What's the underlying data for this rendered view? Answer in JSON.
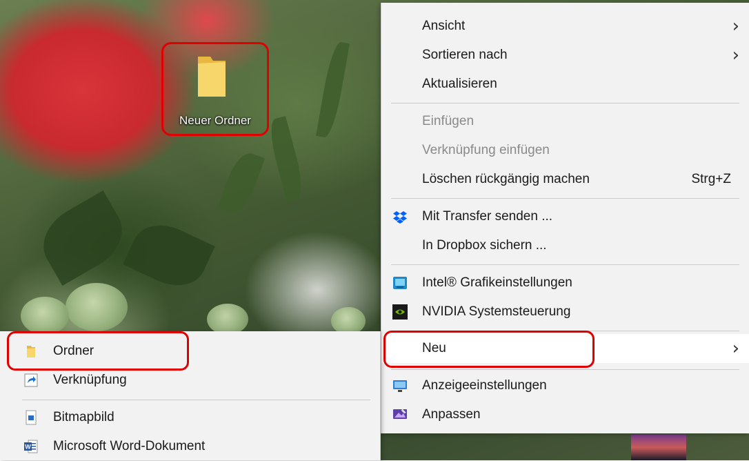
{
  "desktop": {
    "icon": {
      "name": "folder-icon",
      "label": "Neuer Ordner"
    }
  },
  "context_menu": {
    "items": [
      {
        "label": "Ansicht",
        "submenu": true,
        "enabled": true
      },
      {
        "label": "Sortieren nach",
        "submenu": true,
        "enabled": true
      },
      {
        "label": "Aktualisieren",
        "enabled": true
      },
      {
        "label": "Einfügen",
        "enabled": false
      },
      {
        "label": "Verknüpfung einfügen",
        "enabled": false
      },
      {
        "label": "Löschen rückgängig machen",
        "shortcut": "Strg+Z",
        "enabled": true
      },
      {
        "label": "Mit Transfer senden ...",
        "icon": "dropbox-icon",
        "enabled": true
      },
      {
        "label": "In Dropbox sichern ...",
        "enabled": true
      },
      {
        "label": "Intel® Grafikeinstellungen",
        "icon": "intel-graphics-icon",
        "enabled": true
      },
      {
        "label": "NVIDIA Systemsteuerung",
        "icon": "nvidia-icon",
        "enabled": true
      },
      {
        "label": "Neu",
        "submenu": true,
        "enabled": true,
        "highlighted": true
      },
      {
        "label": "Anzeigeeinstellungen",
        "icon": "display-settings-icon",
        "enabled": true
      },
      {
        "label": "Anpassen",
        "icon": "personalize-icon",
        "enabled": true
      }
    ]
  },
  "new_submenu": {
    "items": [
      {
        "label": "Ordner",
        "icon": "folder-icon"
      },
      {
        "label": "Verknüpfung",
        "icon": "shortcut-icon"
      },
      {
        "label": "Bitmapbild",
        "icon": "bitmap-icon"
      },
      {
        "label": "Microsoft Word-Dokument",
        "icon": "word-icon"
      }
    ]
  },
  "colors": {
    "menu_background": "#f2f2f2",
    "disabled_text": "#8a8a8a",
    "highlight_box": "#e00000",
    "folder_yellow": "#f5cd5b",
    "dropbox_blue": "#0061fe",
    "nvidia_green": "#76b900"
  }
}
